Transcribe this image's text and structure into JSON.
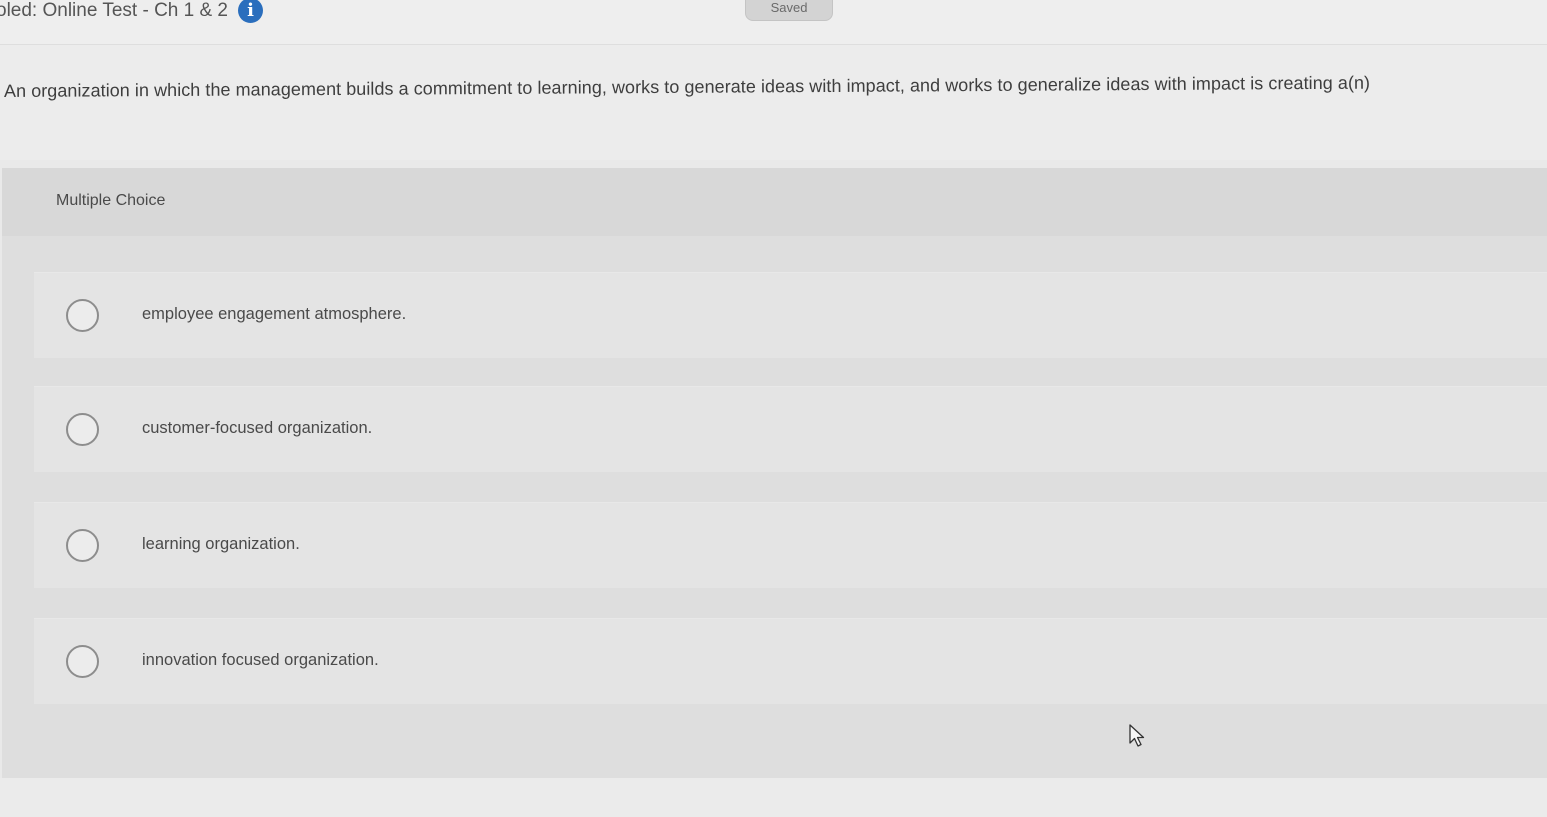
{
  "header": {
    "test_title": "oled: Online Test - Ch 1 & 2",
    "info_icon": "info-icon",
    "save_status": "Saved"
  },
  "question": {
    "text": "An organization in which the management builds a commitment to learning, works to generate ideas with impact, and works to generalize ideas with impact is creating a(n)"
  },
  "answer_panel": {
    "type_label": "Multiple Choice",
    "options": [
      {
        "label": "employee engagement atmosphere.",
        "selected": false
      },
      {
        "label": "customer-focused organization.",
        "selected": false
      },
      {
        "label": "learning organization.",
        "selected": false
      },
      {
        "label": "innovation focused organization.",
        "selected": false
      }
    ]
  },
  "colors": {
    "info_icon": "#2a6ebd",
    "panel_background": "#dedede",
    "option_background": "#e4e4e4",
    "radio_border": "#8d8d8d"
  }
}
